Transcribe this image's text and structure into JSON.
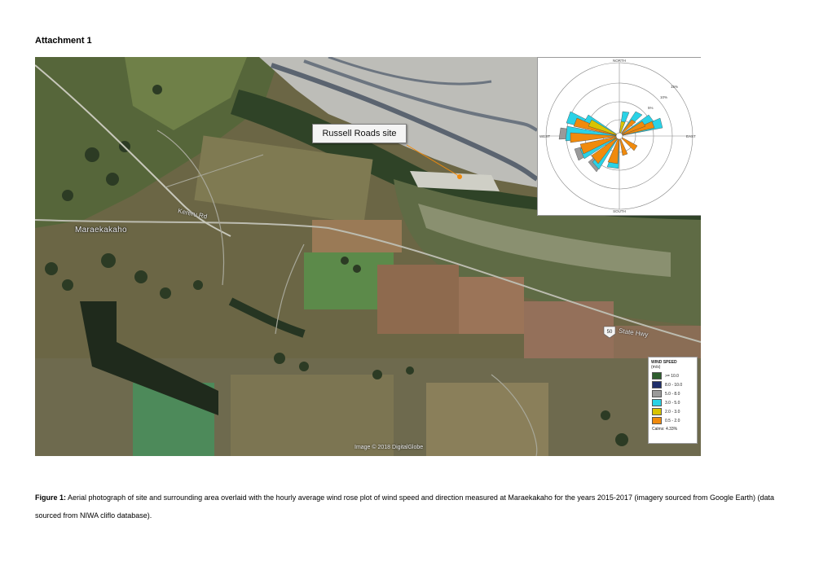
{
  "heading": "Attachment 1",
  "map": {
    "site_label": "Russell Roads site",
    "town_label": "Maraekakaho",
    "road_label_1": "Kereru Rd",
    "road_label_2": "State Hwy",
    "highway_shield": "50",
    "credit": "Image © 2018 DigitalGlobe"
  },
  "wind_rose": {
    "north": "NORTH",
    "south": "SOUTH",
    "east": "EAST",
    "west": "WEST",
    "ring_5": "5%",
    "ring_10": "10%",
    "ring_15": "15%"
  },
  "legend": {
    "title": "WIND SPEED",
    "unit": "(m/s)",
    "items": [
      {
        "label": ">= 10.0",
        "color": "#2e5e2e"
      },
      {
        "label": "8.0 - 10.0",
        "color": "#1f2f6b"
      },
      {
        "label": "5.0 - 8.0",
        "color": "#9a9a9a"
      },
      {
        "label": "3.0 - 5.0",
        "color": "#2ad2e6"
      },
      {
        "label": "2.0 - 3.0",
        "color": "#d8c400"
      },
      {
        "label": "0.5 - 2.0",
        "color": "#f08a0c"
      }
    ],
    "calms": "Calms: 4.33%"
  },
  "caption": {
    "bold": "Figure 1:",
    "text": " Aerial photograph of site and surrounding area overlaid with the hourly average wind rose plot of wind speed and direction measured at Maraekakaho for the years 2015-2017 (imagery sourced from Google Earth)  (data sourced from  NIWA cliflo database)."
  }
}
